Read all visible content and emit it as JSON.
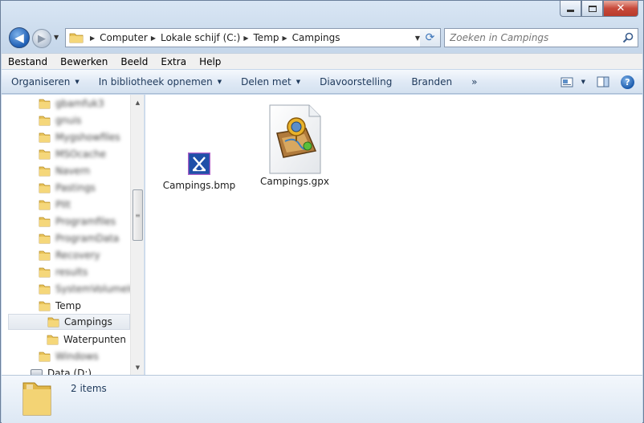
{
  "window": {
    "caption_buttons": {
      "minimize_icon": "minimize-icon",
      "maximize_icon": "maximize-icon",
      "close_icon": "close-icon",
      "close_glyph": "✕"
    }
  },
  "nav": {
    "back_glyph": "◀",
    "forward_glyph": "▶",
    "breadcrumb": [
      "Computer",
      "Lokale schijf (C:)",
      "Temp",
      "Campings"
    ],
    "search_placeholder": "Zoeken in Campings"
  },
  "menu": [
    "Bestand",
    "Bewerken",
    "Beeld",
    "Extra",
    "Help"
  ],
  "commands": {
    "organize": "Organiseren",
    "include_library": "In bibliotheek opnemen",
    "share": "Delen met",
    "slideshow": "Diavoorstelling",
    "burn": "Branden",
    "more": "»",
    "help": "?"
  },
  "tree": {
    "blurred_items": [
      "gbamfuk3",
      "gnuis",
      "Mygshowfiles",
      "MSOcache",
      "Navern",
      "Pastings",
      "PIIt",
      "Programfiles",
      "ProgramData",
      "Recovery",
      "results",
      "SystemVolumeInfo"
    ],
    "temp": "Temp",
    "campings": "Campings",
    "waterpunten": "Waterpunten",
    "windows_blurred": "Windows",
    "data_drive": "Data (D:)"
  },
  "files": [
    {
      "name": "Campings.bmp",
      "icon": "camping-tent-icon"
    },
    {
      "name": "Campings.gpx",
      "icon": "gpx-map-file-icon"
    }
  ],
  "status": {
    "item_count": "2 items"
  },
  "colors": {
    "accent": "#1e395b",
    "selection": "#e3e8ef",
    "tent_blue": "#1f4fa8"
  }
}
